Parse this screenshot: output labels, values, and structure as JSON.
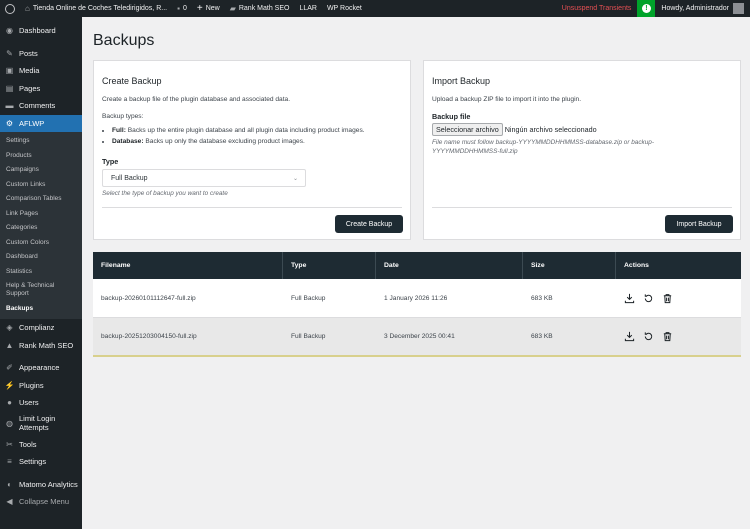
{
  "adminbar": {
    "site_name": "Tienda Online de Coches Teledirigidos, R...",
    "comments_count": "0",
    "new_label": "New",
    "rank_math_label": "Rank Math SEO",
    "llar_label": "LLAR",
    "wp_rocket_label": "WP Rocket",
    "unsuspend_label": "Unsuspend Transients",
    "howdy_label": "Howdy, Administrador"
  },
  "sidebar": {
    "items": [
      {
        "label": "Dashboard",
        "icon": "dashboard-icon"
      },
      {
        "label": "Posts",
        "icon": "pin-icon"
      },
      {
        "label": "Media",
        "icon": "media-icon"
      },
      {
        "label": "Pages",
        "icon": "pages-icon"
      },
      {
        "label": "Comments",
        "icon": "comments-icon"
      },
      {
        "label": "AFLWP",
        "icon": "aflwp-icon"
      }
    ],
    "submenu": [
      "Settings",
      "Products",
      "Campaigns",
      "Custom Links",
      "Comparison Tables",
      "Link Pages",
      "Categories",
      "Custom Colors",
      "Dashboard",
      "Statistics",
      "Help & Technical Support",
      "Backups"
    ],
    "items2": [
      {
        "label": "Complianz"
      },
      {
        "label": "Rank Math SEO"
      },
      {
        "label": "Appearance"
      },
      {
        "label": "Plugins"
      },
      {
        "label": "Users"
      },
      {
        "label": "Limit Login Attempts"
      },
      {
        "label": "Tools"
      },
      {
        "label": "Settings"
      },
      {
        "label": "Matomo Analytics"
      },
      {
        "label": "Collapse Menu"
      }
    ]
  },
  "page": {
    "title": "Backups"
  },
  "create": {
    "title": "Create Backup",
    "description": "Create a backup file of the plugin database and associated data.",
    "types_label": "Backup types:",
    "full_label": "Full:",
    "full_text": "Backs up the entire plugin database and all plugin data including product images.",
    "db_label": "Database:",
    "db_text": "Backs up only the database excluding product images.",
    "type_label": "Type",
    "type_value": "Full Backup",
    "type_help": "Select the type of backup you want to create",
    "button": "Create Backup"
  },
  "import": {
    "title": "Import Backup",
    "description": "Upload a backup ZIP file to import it into the plugin.",
    "file_label": "Backup file",
    "file_button": "Seleccionar archivo",
    "file_none": "Ningún archivo seleccionado",
    "help": "File name must follow backup-YYYYMMDDHHMMSS-database.zip or backup-YYYYMMDDHHMMSS-full.zip",
    "button": "Import Backup"
  },
  "table": {
    "headers": [
      "Filename",
      "Type",
      "Date",
      "Size",
      "Actions"
    ],
    "rows": [
      {
        "filename": "backup-20260101112647-full.zip",
        "type": "Full Backup",
        "date": "1 January 2026 11:26",
        "size": "683 KB"
      },
      {
        "filename": "backup-20251203004150-full.zip",
        "type": "Full Backup",
        "date": "3 December 2025 00:41",
        "size": "683 KB"
      }
    ]
  }
}
